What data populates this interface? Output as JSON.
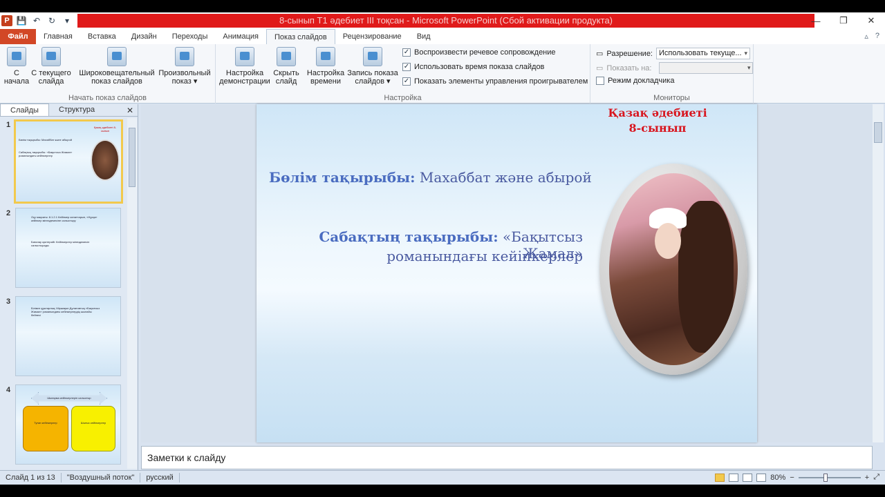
{
  "window": {
    "title": "8-сынып Т1 әдебиет III тоқсан - Microsoft PowerPoint (Сбой активации продукта)",
    "minimize": "—",
    "restore": "❐",
    "close": "✕"
  },
  "qat": {
    "app_icon": "P"
  },
  "tabs": [
    {
      "label": "Файл"
    },
    {
      "label": "Главная"
    },
    {
      "label": "Вставка"
    },
    {
      "label": "Дизайн"
    },
    {
      "label": "Переходы"
    },
    {
      "label": "Анимация"
    },
    {
      "label": "Показ слайдов"
    },
    {
      "label": "Рецензирование"
    },
    {
      "label": "Вид"
    }
  ],
  "ribbon": {
    "start": {
      "label": "Начать показ слайдов",
      "from_start": "С начала",
      "from_current": "С текущего слайда",
      "broadcast": "Широковещательный показ слайдов",
      "custom": "Произвольный показ ▾"
    },
    "setup": {
      "label": "Настройка",
      "setup_show": "Настройка демонстрации",
      "hide_slide": "Скрыть слайд",
      "rehearse": "Настройка времени",
      "record": "Запись показа слайдов ▾",
      "chk_narration": "Воспроизвести речевое сопровождение",
      "chk_timings": "Использовать время показа слайдов",
      "chk_media": "Показать элементы управления проигрывателем"
    },
    "monitors": {
      "label": "Мониторы",
      "resolution_label": "Разрешение:",
      "resolution_value": "Использовать текуще...",
      "show_on_label": "Показать на:",
      "show_on_value": "",
      "presenter_view": "Режим докладчика"
    }
  },
  "pane": {
    "tab_slides": "Слайды",
    "tab_outline": "Структура",
    "close": "✕"
  },
  "thumbnails": [
    {
      "num": "1",
      "title": "Қазақ әдебиеті 8-сынып",
      "line1": "Бөлім тақырыбы: Махаббат және абырой",
      "line2": "Сабақтың тақырыбы: «Бақытсыз Жамал» романындағы кейіпкерлер"
    },
    {
      "num": "2",
      "line1": "Оқу мақсаты: 8.1.2.1 Кейіпкер сипаттарын, «Нұсқа» кейіпкер мінездемесіне салыстыру",
      "line2": "Бағалау критерийі: Кейіпкерлер мінездемесін салыстырады"
    },
    {
      "num": "3",
      "line1": "Білімге құштарлық: Міржақып Дулатовтың «Бақытсыз Жамал» романындағы кейіпкерлердің шынайы бейнесі"
    },
    {
      "num": "4",
      "line1": "Шығарма кейіпкерлерін салыстыр",
      "line2": "Туған кейіпкерлер",
      "line3": "Шығыс кейіпкерлер"
    }
  ],
  "slide": {
    "title_line1": "Қазақ әдебиеті",
    "title_line2": "8-сынып",
    "section_label": "Бөлім тақырыбы:",
    "section_value": "Махаббат және абырой",
    "lesson_label": "Сабақтың тақырыбы:",
    "lesson_value1": "«Бақытсыз Жамал»",
    "lesson_value2": "романындағы кейіпкерлер"
  },
  "notes": {
    "placeholder": "Заметки к слайду"
  },
  "status": {
    "slide_info": "Слайд 1 из 13",
    "theme": "\"Воздушный поток\"",
    "language": "русский",
    "zoom": "80%",
    "zoom_out": "−",
    "zoom_in": "+"
  }
}
